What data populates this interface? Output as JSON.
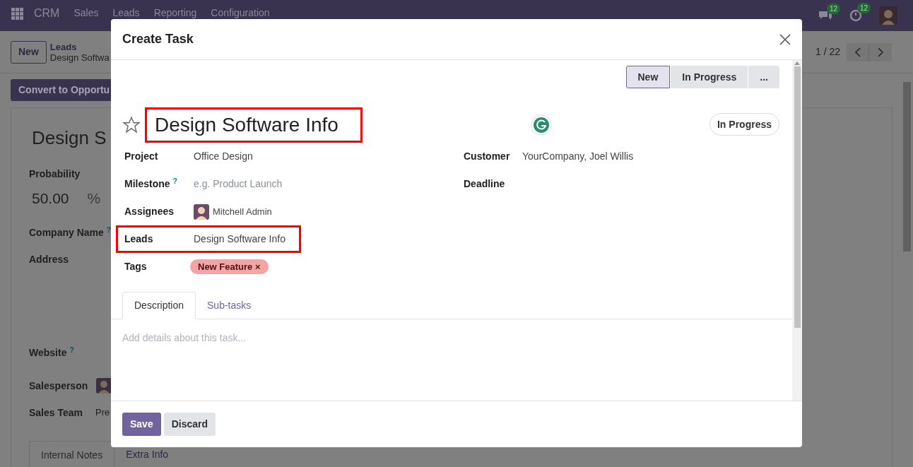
{
  "navbar": {
    "app": "CRM",
    "menu": [
      "Sales",
      "Leads",
      "Reporting",
      "Configuration"
    ],
    "messages_badge": "12",
    "activities_badge": "12"
  },
  "control_panel": {
    "new_button": "New",
    "breadcrumb_parent": "Leads",
    "breadcrumb_current": "Design Softwa",
    "pager": "1 / 22"
  },
  "lead_form": {
    "convert_button": "Convert to Opportu",
    "title": "Design S",
    "fields": [
      {
        "kind": "probability",
        "label": "Probability",
        "value": "50.00",
        "unit": "%"
      },
      {
        "kind": "plain",
        "label": "Company Name",
        "help": "?"
      },
      {
        "kind": "address",
        "label": "Address"
      },
      {
        "kind": "plain",
        "label": "Website",
        "help": "?"
      },
      {
        "kind": "user",
        "label": "Salesperson"
      },
      {
        "kind": "text",
        "label": "Sales Team",
        "value": "Pre"
      }
    ],
    "tabs": [
      {
        "label": "Internal Notes",
        "selected": true
      },
      {
        "label": "Extra Info",
        "selected": false
      }
    ]
  },
  "dialog": {
    "title": "Create Task",
    "stages": [
      {
        "label": "New",
        "selected": true
      },
      {
        "label": "In Progress",
        "selected": false
      },
      {
        "label": "...",
        "selected": false
      }
    ],
    "starred": false,
    "task_name": "Design Software Info",
    "state": "In Progress",
    "left_fields": [
      {
        "kind": "text",
        "label": "Project",
        "value": "Office Design",
        "highlighted": false
      },
      {
        "kind": "placeholder",
        "label": "Milestone",
        "help": "?",
        "placeholder": "e.g. Product Launch",
        "highlighted": false
      },
      {
        "kind": "user",
        "label": "Assignees",
        "value": "Mitchell Admin",
        "highlighted": false
      },
      {
        "kind": "text",
        "label": "Leads",
        "value": "Design Software Info",
        "highlighted": true
      },
      {
        "kind": "tags",
        "label": "Tags",
        "tags": [
          {
            "label": "New Feature",
            "color": "#f4a4a4",
            "remove": "×"
          }
        ],
        "highlighted": false
      }
    ],
    "right_fields": [
      {
        "label": "Customer",
        "value": "YourCompany, Joel Willis"
      },
      {
        "label": "Deadline"
      }
    ],
    "tabs": [
      {
        "label": "Description",
        "selected": true
      },
      {
        "label": "Sub-tasks",
        "selected": false
      }
    ],
    "description_placeholder": "Add details about this task...",
    "buttons": [
      {
        "label": "Save",
        "kind": "primary"
      },
      {
        "label": "Discard",
        "kind": "secondary"
      }
    ]
  }
}
